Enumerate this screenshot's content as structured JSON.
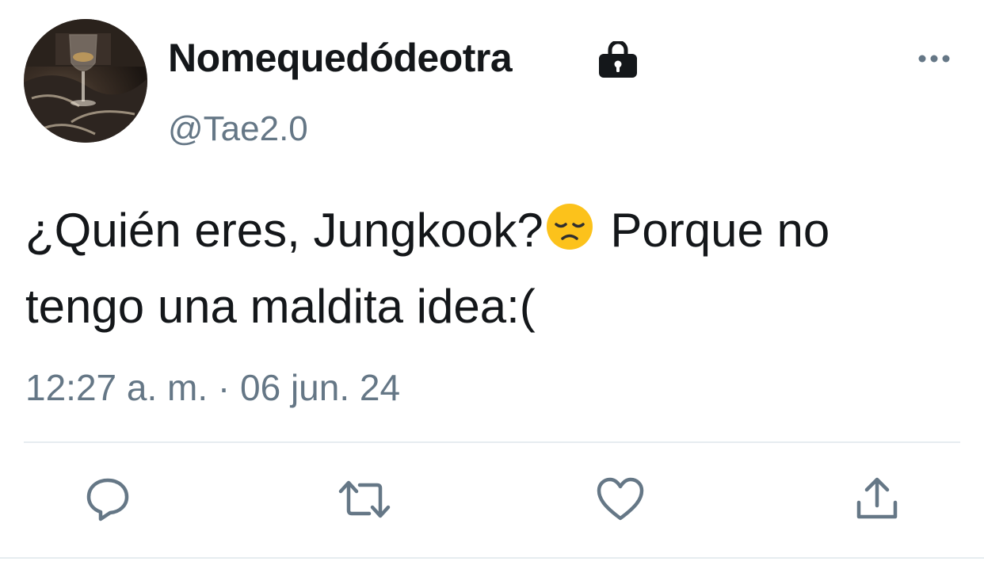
{
  "tweet": {
    "display_name": "Nomequedódeotra",
    "handle": "@Tae2.0",
    "text_part1": "¿Quién eres, Jungkook?",
    "emoji_name": "disappointed-face-emoji",
    "text_part2": " Porque no tengo una maldita idea:(",
    "timestamp": "12:27 a. m. · 06 jun. 24",
    "protected_account": true
  },
  "actions": {
    "reply_icon": "reply-icon",
    "retweet_icon": "retweet-icon",
    "like_icon": "heart-icon",
    "share_icon": "share-icon",
    "more_icon": "more-options-icon"
  },
  "colors": {
    "text": "#14171a",
    "secondary": "#657786",
    "divider": "#e6ecf0",
    "emoji": "#fcc21b"
  }
}
